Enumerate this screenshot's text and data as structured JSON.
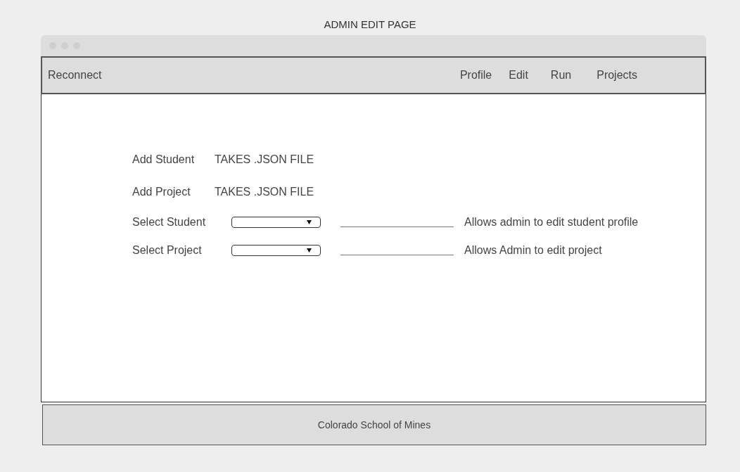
{
  "page_title": "ADMIN EDIT PAGE",
  "navbar": {
    "brand": "Reconnect",
    "links": [
      "Profile",
      "Edit",
      "Run",
      "Projects"
    ]
  },
  "upload_rows": [
    {
      "label": "Add Student",
      "note": "TAKES .JSON FILE"
    },
    {
      "label": "Add Project",
      "note": "TAKES .JSON FILE"
    }
  ],
  "select_rows": [
    {
      "label": "Select Student",
      "annotation": "Allows admin to edit student profile"
    },
    {
      "label": "Select Project",
      "annotation": "Allows Admin to edit project"
    }
  ],
  "footer": "Colorado School of Mines"
}
